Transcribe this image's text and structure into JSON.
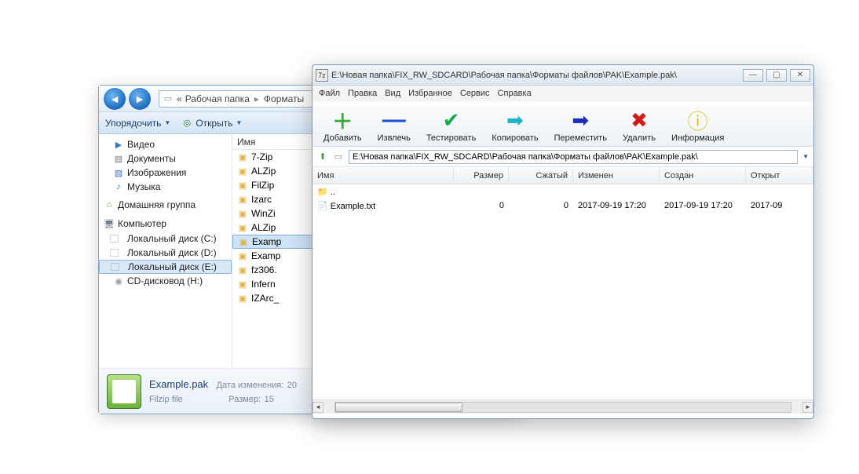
{
  "explorer": {
    "breadcrumb_prefix": "«",
    "breadcrumb1": "Рабочая папка",
    "breadcrumb2": "Форматы",
    "toolbar_organize": "Упорядочить",
    "toolbar_open": "Открыть",
    "tree": {
      "video": "Видео",
      "docs": "Документы",
      "images": "Изображения",
      "music": "Музыка",
      "homegroup": "Домашняя группа",
      "computer": "Компьютер",
      "drive_c": "Локальный диск (C:)",
      "drive_d": "Локальный диск (D:)",
      "drive_e": "Локальный диск (E:)",
      "cd": "CD-дисковод (H:)"
    },
    "list_header": "Имя",
    "files": [
      "7-Zip",
      "ALZip",
      "FilZip",
      "Izarc",
      "WinZi",
      "ALZip",
      "Examp",
      "Examp",
      "fz306.",
      "Infern",
      "IZArc_"
    ],
    "status_name": "Example.pak",
    "status_filetype": "Filzip file",
    "status_date_label": "Дата изменения:",
    "status_date_val": "20",
    "status_size_label": "Размер:",
    "status_size_val": "15"
  },
  "sevenzip": {
    "title": "E:\\Новая папка\\FIX_RW_SDCARD\\Рабочая папка\\Форматы файлов\\PAK\\Example.pak\\",
    "win_min": "—",
    "win_max": "▢",
    "win_close": "✕",
    "menu": [
      "Файл",
      "Правка",
      "Вид",
      "Избранное",
      "Сервис",
      "Справка"
    ],
    "tools": {
      "add": {
        "label": "Добавить",
        "icon": "＋",
        "color": "#2eae2e"
      },
      "extract": {
        "label": "Извлечь",
        "icon": "—",
        "color": "#1a52d6"
      },
      "test": {
        "label": "Тестировать",
        "icon": "✔",
        "color": "#15aa4c"
      },
      "copy": {
        "label": "Копировать",
        "icon": "➡",
        "color": "#1eb6c6"
      },
      "move": {
        "label": "Переместить",
        "icon": "➡",
        "color": "#1a2fbf"
      },
      "delete": {
        "label": "Удалить",
        "icon": "✖",
        "color": "#d11a1a"
      },
      "info": {
        "label": "Информация",
        "icon": "ⓘ",
        "color": "#d7c81a"
      }
    },
    "addr_value": "E:\\Новая папка\\FIX_RW_SDCARD\\Рабочая папка\\Форматы файлов\\PAK\\Example.pak\\",
    "cols": {
      "name": "Имя",
      "size": "Размер",
      "packed": "Сжатый",
      "modified": "Изменен",
      "created": "Создан",
      "opened": "Открыт"
    },
    "rows": [
      {
        "name": "..",
        "size": "",
        "packed": "",
        "modified": "",
        "created": "",
        "opened": "",
        "is_up": true
      },
      {
        "name": "Example.txt",
        "size": "0",
        "packed": "0",
        "modified": "2017-09-19 17:20",
        "created": "2017-09-19 17:20",
        "opened": "2017-09"
      }
    ]
  }
}
